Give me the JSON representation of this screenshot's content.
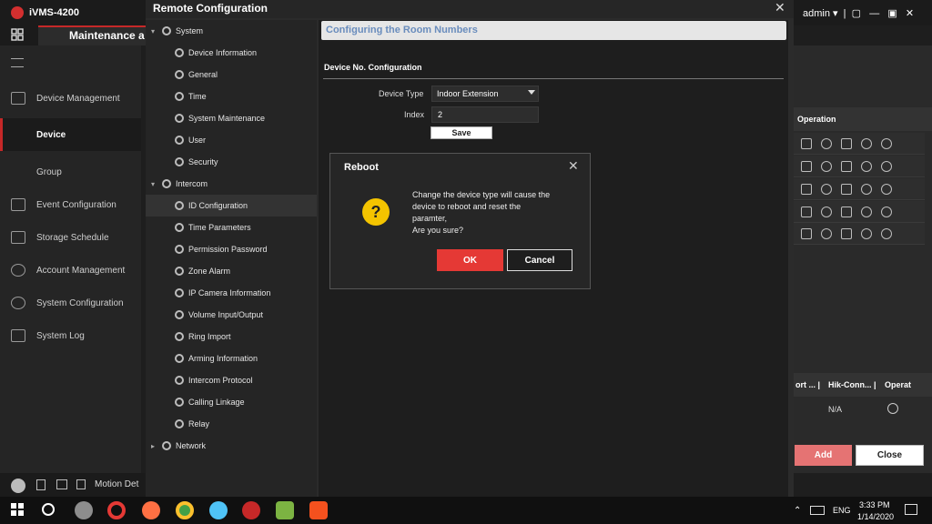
{
  "app": {
    "name": "iVMS-4200",
    "tab_label": "Maintenance a",
    "user": "admin"
  },
  "left_nav": [
    {
      "label": "Device Management"
    },
    {
      "label": "Device"
    },
    {
      "label": "Group"
    },
    {
      "label": "Event Configuration"
    },
    {
      "label": "Storage Schedule"
    },
    {
      "label": "Account Management"
    },
    {
      "label": "System Configuration"
    },
    {
      "label": "System Log"
    }
  ],
  "bottom_status": {
    "motion_label": "Motion Det"
  },
  "right_panel": {
    "operation_header": "Operation",
    "columns": [
      "ort ... |",
      "Hik-Conn... |",
      "Operat"
    ],
    "na_value": "N/A",
    "add_label": "Add",
    "close_label": "Close"
  },
  "remote_config": {
    "title": "Remote Configuration",
    "close_glyph": "✕",
    "tree": [
      {
        "label": "System",
        "level": 0
      },
      {
        "label": "Device Information",
        "level": 1
      },
      {
        "label": "General",
        "level": 1
      },
      {
        "label": "Time",
        "level": 1
      },
      {
        "label": "System Maintenance",
        "level": 1
      },
      {
        "label": "User",
        "level": 1
      },
      {
        "label": "Security",
        "level": 1
      },
      {
        "label": "Intercom",
        "level": 0
      },
      {
        "label": "ID Configuration",
        "level": 1
      },
      {
        "label": "Time Parameters",
        "level": 1
      },
      {
        "label": "Permission Password",
        "level": 1
      },
      {
        "label": "Zone Alarm",
        "level": 1
      },
      {
        "label": "IP Camera Information",
        "level": 1
      },
      {
        "label": "Volume Input/Output",
        "level": 1
      },
      {
        "label": "Ring Import",
        "level": 1
      },
      {
        "label": "Arming Information",
        "level": 1
      },
      {
        "label": "Intercom Protocol",
        "level": 1
      },
      {
        "label": "Calling Linkage",
        "level": 1
      },
      {
        "label": "Relay",
        "level": 1
      },
      {
        "label": "Network",
        "level": 0
      }
    ],
    "section_banner": "Configuring the Room Numbers",
    "device_no_title": "Device No. Configuration",
    "device_type_label": "Device Type",
    "device_type_value": "Indoor Extension",
    "index_label": "Index",
    "index_value": "2",
    "save_label": "Save"
  },
  "dialog": {
    "title": "Reboot",
    "close_glyph": "✕",
    "icon": "?",
    "lines": [
      "Change the device type will cause the",
      "device to reboot and reset the",
      "paramter,",
      "Are you sure?"
    ],
    "ok_label": "OK",
    "cancel_label": "Cancel"
  },
  "taskbar": {
    "lang": "ENG",
    "time": "3:33 PM",
    "date": "1/14/2020",
    "icons": [
      "windows-icon",
      "search-icon",
      "app-icon",
      "opera-icon",
      "firefox-icon",
      "chrome-icon",
      "edge-icon",
      "ivms-icon",
      "camtasia-icon",
      "camtasia-recorder-icon"
    ]
  }
}
